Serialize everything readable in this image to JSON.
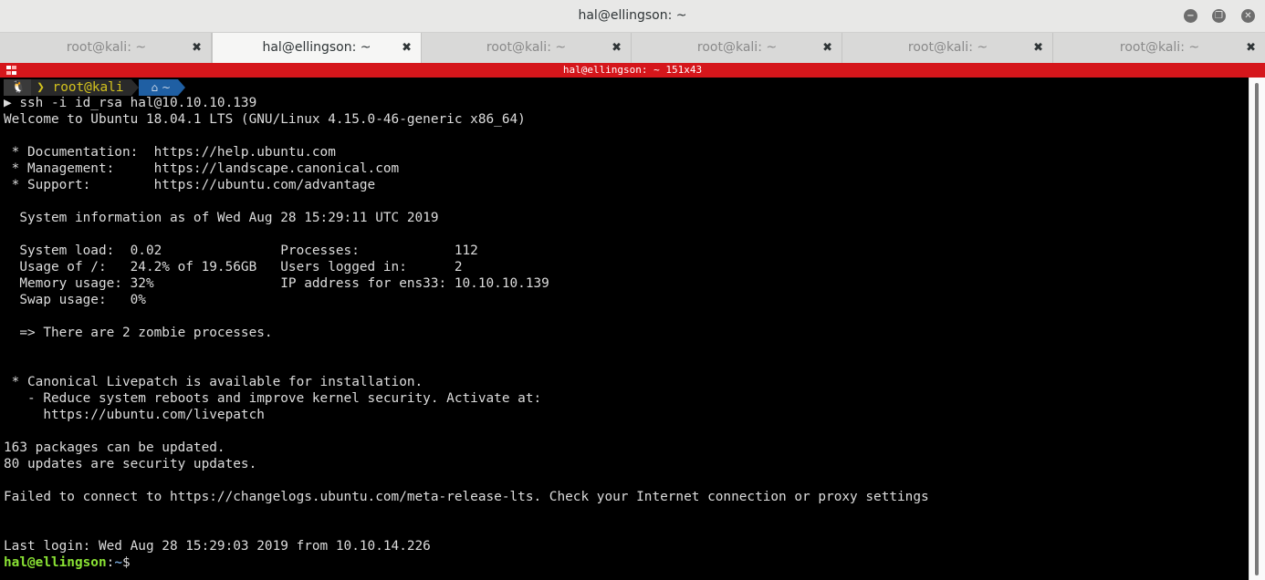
{
  "window": {
    "title": "hal@ellingson: ~",
    "minimize_glyph": "−",
    "maximize_glyph": "❐",
    "close_glyph": "✕"
  },
  "tabs": [
    {
      "label": "root@kali: ~",
      "active": false
    },
    {
      "label": "hal@ellingson: ~",
      "active": true
    },
    {
      "label": "root@kali: ~",
      "active": false
    },
    {
      "label": "root@kali: ~",
      "active": false
    },
    {
      "label": "root@kali: ~",
      "active": false
    },
    {
      "label": "root@kali: ~",
      "active": false
    }
  ],
  "tab_close_glyph": "✖",
  "status_bar": {
    "title": "hal@ellingson: ~ 151x43",
    "color": "#d5161b"
  },
  "prompt": {
    "os_icon": "linux-tux-icon",
    "os_glyph": "🐧",
    "sep_glyph": "❯",
    "user": "root@kali",
    "path_icon": "home-icon",
    "path_glyph": "⌂",
    "path": "~"
  },
  "terminal": {
    "lines": [
      "▶ ssh -i id_rsa hal@10.10.10.139",
      "Welcome to Ubuntu 18.04.1 LTS (GNU/Linux 4.15.0-46-generic x86_64)",
      "",
      " * Documentation:  https://help.ubuntu.com",
      " * Management:     https://landscape.canonical.com",
      " * Support:        https://ubuntu.com/advantage",
      "",
      "  System information as of Wed Aug 28 15:29:11 UTC 2019",
      "",
      "  System load:  0.02               Processes:            112",
      "  Usage of /:   24.2% of 19.56GB   Users logged in:      2",
      "  Memory usage: 32%                IP address for ens33: 10.10.10.139",
      "  Swap usage:   0%",
      "",
      "  => There are 2 zombie processes.",
      "",
      "",
      " * Canonical Livepatch is available for installation.",
      "   - Reduce system reboots and improve kernel security. Activate at:",
      "     https://ubuntu.com/livepatch",
      "",
      "163 packages can be updated.",
      "80 updates are security updates.",
      "",
      "Failed to connect to https://changelogs.ubuntu.com/meta-release-lts. Check your Internet connection or proxy settings",
      "",
      "",
      "Last login: Wed Aug 28 15:29:03 2019 from 10.10.14.226"
    ],
    "final_prompt": {
      "user_host": "hal@ellingson",
      "sep": ":",
      "path": "~",
      "symbol": "$"
    }
  }
}
